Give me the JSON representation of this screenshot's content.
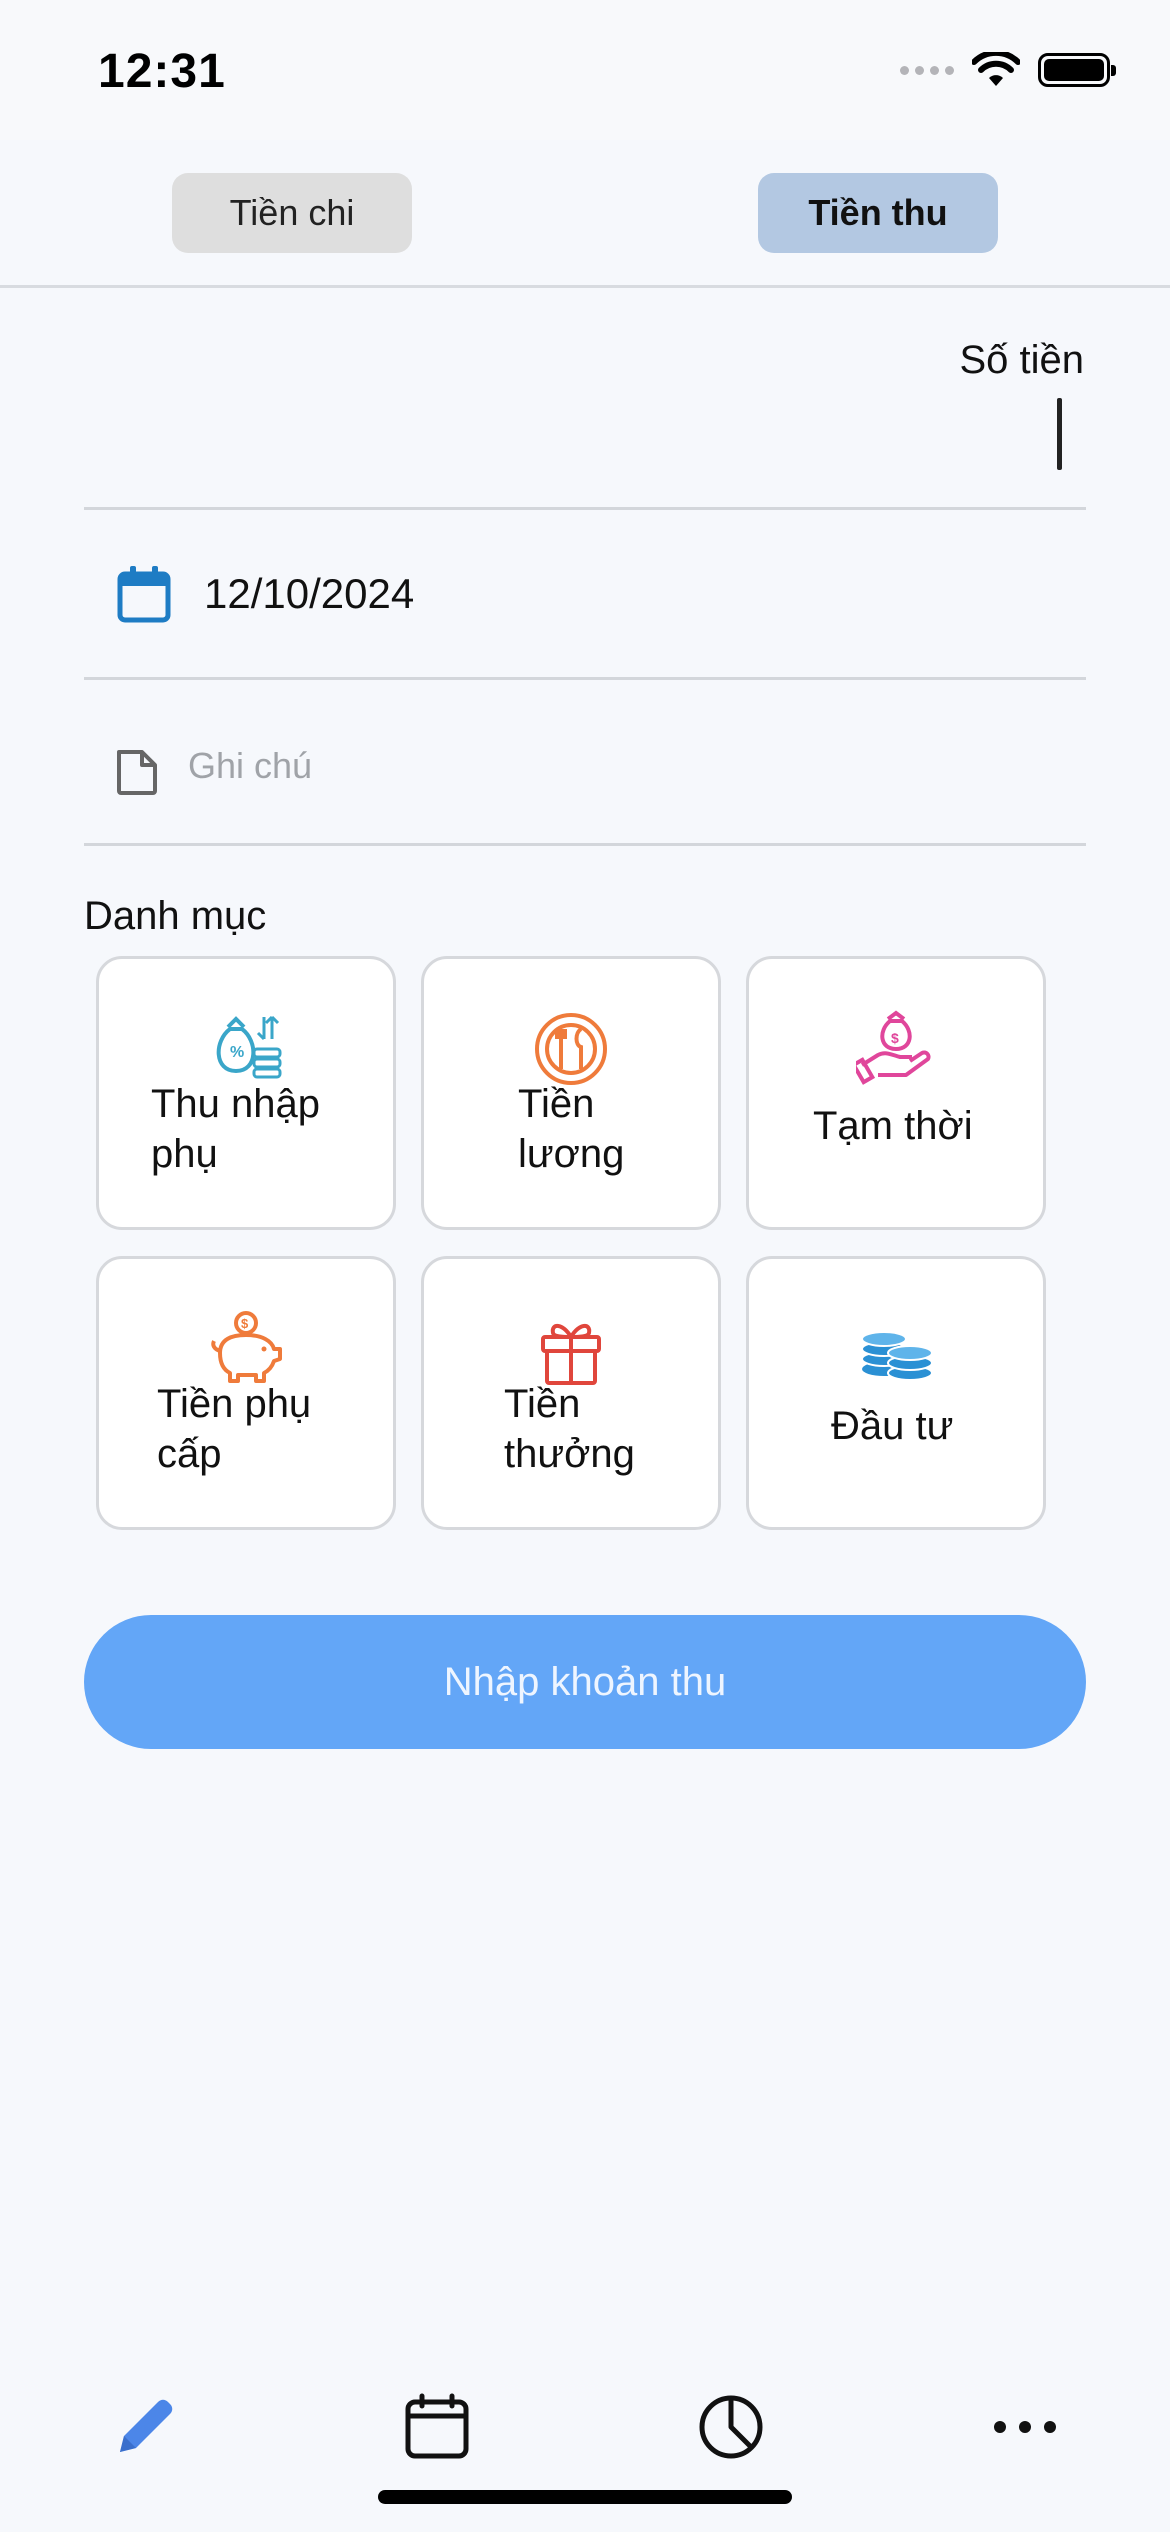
{
  "status_bar": {
    "time": "12:31"
  },
  "segment": {
    "expense_label": "Tiền chi",
    "income_label": "Tiền thu",
    "selected": "Tiền thu"
  },
  "amount": {
    "label": "Số tiền",
    "value": ""
  },
  "date": {
    "value": "12/10/2024"
  },
  "note": {
    "placeholder": "Ghi chú",
    "value": ""
  },
  "category": {
    "title": "Danh mục",
    "items": [
      {
        "line1": "Thu nhập",
        "line2": "phụ",
        "icon": "money-bag-icon",
        "color": "#3aa6c9"
      },
      {
        "line1": "Tiền",
        "line2": "lương",
        "icon": "salary-plate-icon",
        "color": "#ef7b3b"
      },
      {
        "line1": "Tạm thời",
        "line2": "",
        "icon": "hand-money-icon",
        "color": "#e0469b"
      },
      {
        "line1": "Tiền phụ",
        "line2": "cấp",
        "icon": "piggy-bank-icon",
        "color": "#ef7b3b"
      },
      {
        "line1": "Tiền",
        "line2": "thưởng",
        "icon": "gift-icon",
        "color": "#e0463c"
      },
      {
        "line1": "Đầu tư",
        "line2": "",
        "icon": "coin-stack-icon",
        "color": "#2a90d4"
      }
    ]
  },
  "submit": {
    "label": "Nhập khoản thu"
  },
  "tab_bar": {
    "tabs": [
      {
        "icon": "pencil-icon",
        "active": true
      },
      {
        "icon": "calendar-icon",
        "active": false
      },
      {
        "icon": "pie-chart-icon",
        "active": false
      },
      {
        "icon": "more-icon",
        "active": false
      }
    ]
  },
  "colors": {
    "accent": "#63a6f7",
    "active_tab": "#4c86e8",
    "segment_selected": "#b3c8e2",
    "segment_unselected": "#dedede",
    "background": "#f6f8fc"
  }
}
